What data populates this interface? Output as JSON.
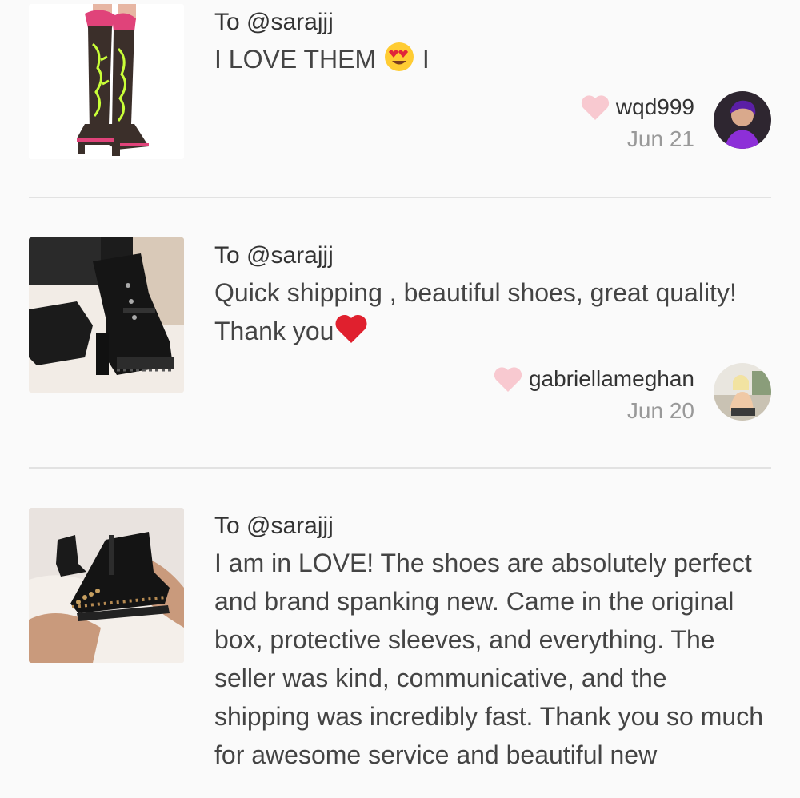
{
  "reviews": [
    {
      "to": "To @sarajjj",
      "text_main": "I LOVE THEM ",
      "text_emoji": "heart-eyes-emoji",
      "text_tail": " I",
      "username": "wqd999",
      "date": "Jun 21"
    },
    {
      "to": "To @sarajjj",
      "text_main": "Quick shipping , beautiful shoes, great quality! Thank you",
      "text_emoji": "red-heart-emoji",
      "username": "gabriellameghan",
      "date": "Jun 20"
    },
    {
      "to": "To @sarajjj",
      "text_main": "I am in LOVE! The shoes are absolutely perfect and brand spanking new. Came in the original box, protective sleeves, and everything. The seller was kind, communicative, and the shipping was incredibly fast. Thank you so much for awesome service and beautiful new"
    }
  ],
  "colors": {
    "background": "#fafafa",
    "divider": "#e2e2e2",
    "heart": "#f8c9d0",
    "date": "#999999"
  }
}
